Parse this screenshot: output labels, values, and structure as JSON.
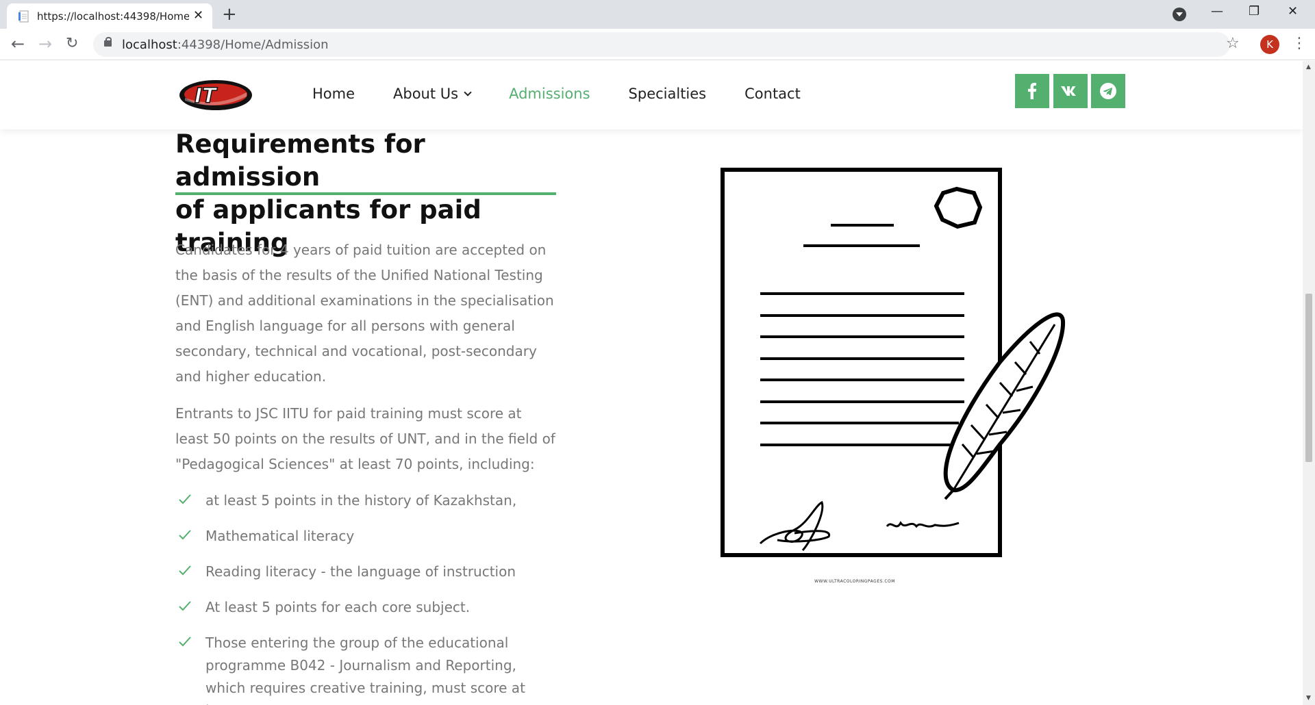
{
  "browser": {
    "tab_title": "https://localhost:44398/Home/Admission",
    "url_host": "localhost",
    "url_rest": ":44398/Home/Admission",
    "profile_initial": "K"
  },
  "nav": {
    "items": [
      {
        "label": "Home"
      },
      {
        "label": "About Us",
        "has_dropdown": true
      },
      {
        "label": "Admissions",
        "active": true
      },
      {
        "label": "Specialties"
      },
      {
        "label": "Contact"
      }
    ]
  },
  "social": [
    {
      "name": "facebook-icon"
    },
    {
      "name": "vk-icon"
    },
    {
      "name": "telegram-icon"
    }
  ],
  "content": {
    "title_line1": "Requirements for admission",
    "title_line2": "of applicants for paid training",
    "paragraph1": "Candidates for 4 years of paid tuition are accepted on the basis of the results of the Unified National Testing (ENT) and additional examinations in the specialisation and English language for all persons with general secondary, technical and vocational, post-secondary and higher education.",
    "paragraph2": "Entrants to JSC IITU for paid training must score at least 50 points on the results of UNT, and in the field of \"Pedagogical Sciences\" at least 70 points, including:",
    "requirements": [
      "at least 5 points in the history of Kazakhstan,",
      "Mathematical literacy",
      "Reading literacy - the language of instruction",
      "At least 5 points for each core subject.",
      "Those entering the group of the educational programme B042 - Journalism and Reporting, which requires creative training, must score at least"
    ],
    "illustration_credit": "WWW.ULTRACOLORINGPAGES.COM"
  },
  "colors": {
    "accent": "#53b06f",
    "logo_red": "#c8241b",
    "avatar": "#c5311f"
  }
}
